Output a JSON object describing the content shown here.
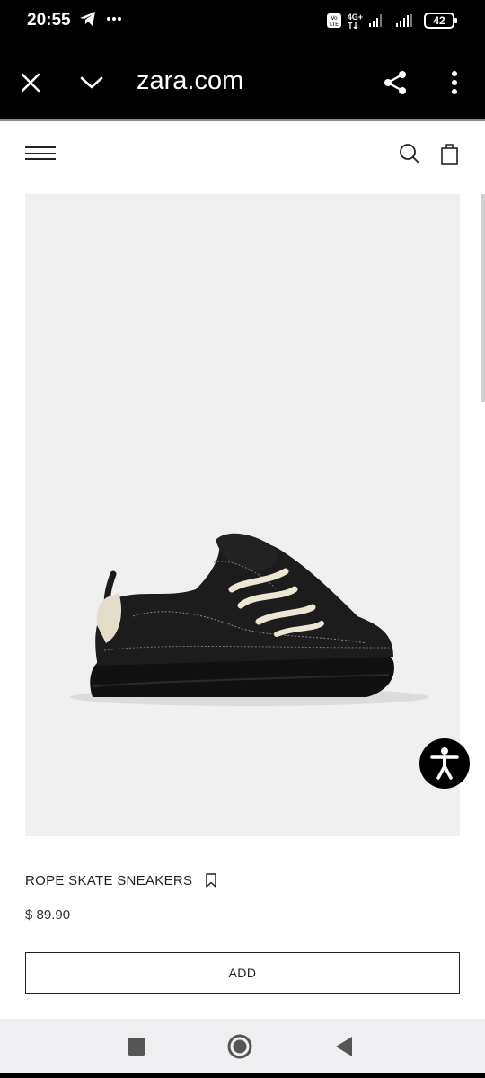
{
  "status_bar": {
    "time": "20:55",
    "network": "4G+",
    "battery": "42",
    "icons": [
      "telegram-icon",
      "more-dots-icon",
      "volte-icon",
      "signal-icon",
      "signal-icon",
      "battery-icon"
    ]
  },
  "browser": {
    "url": "zara.com",
    "icons": [
      "close-icon",
      "chevron-down-icon",
      "share-icon",
      "more-vert-icon"
    ]
  },
  "site_header": {
    "icons": [
      "menu-icon",
      "search-icon",
      "bag-icon"
    ]
  },
  "product": {
    "name": "ROPE SKATE SNEAKERS",
    "price": "$ 89.90",
    "add_label": "ADD",
    "image_icon": "sneaker-image",
    "bookmark_icon": "bookmark-icon"
  },
  "accessibility": {
    "icon": "accessibility-icon"
  },
  "nav_bar": {
    "icons": [
      "recent-apps-icon",
      "home-icon",
      "back-icon"
    ]
  },
  "colors": {
    "status_bg": "#000000",
    "image_bg": "#f0f0f0",
    "nav_bg": "#efeff1",
    "text": "#222222"
  }
}
